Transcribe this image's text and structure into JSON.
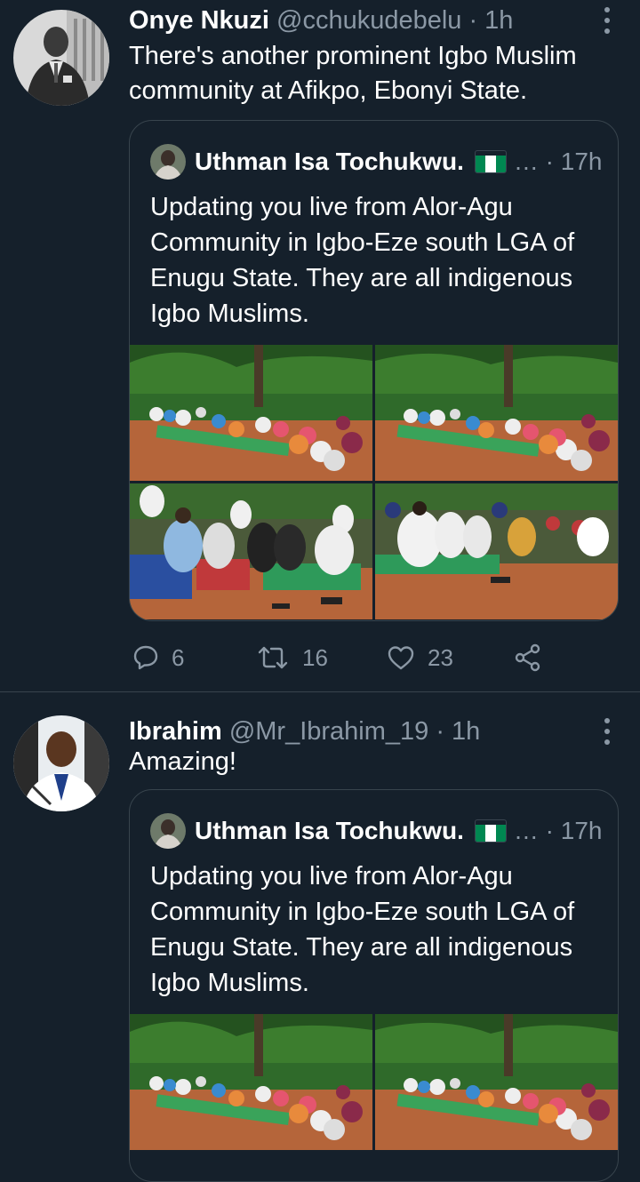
{
  "tweets": [
    {
      "author_name": "Onye Nkuzi",
      "author_meta": "@cchukudebelu · 1h",
      "text_lines": [
        "There's another prominent Igbo Muslim",
        "community at Afikpo, Ebonyi State."
      ],
      "quote": {
        "author_name": "Uthman Isa Tochukwu.",
        "flag_icon": "nigeria-flag-icon",
        "meta": "… · 17h",
        "text_lines": [
          "Updating you live from Alor-Agu",
          "Community in Igbo-Eze south LGA of",
          "Enugu State. They are all indigenous",
          "Igbo Muslims."
        ]
      },
      "actions": {
        "reply_count": "6",
        "retweet_count": "16",
        "like_count": "23",
        "reply_icon": "reply-icon",
        "retweet_icon": "retweet-icon",
        "like_icon": "heart-icon",
        "share_icon": "share-icon"
      }
    },
    {
      "author_name": "Ibrahim",
      "author_meta": "@Mr_Ibrahim_19 · 1h",
      "text_lines": [
        "Amazing!"
      ],
      "quote": {
        "author_name": "Uthman Isa Tochukwu.",
        "flag_icon": "nigeria-flag-icon",
        "meta": "… · 17h",
        "text_lines": [
          "Updating you live from Alor-Agu",
          "Community in Igbo-Eze south LGA of",
          "Enugu State. They are all indigenous",
          "Igbo Muslims."
        ]
      }
    }
  ],
  "colors": {
    "background": "#15202b",
    "border": "#38444d",
    "muted_text": "#8b98a5",
    "flag_green": "#008751"
  }
}
